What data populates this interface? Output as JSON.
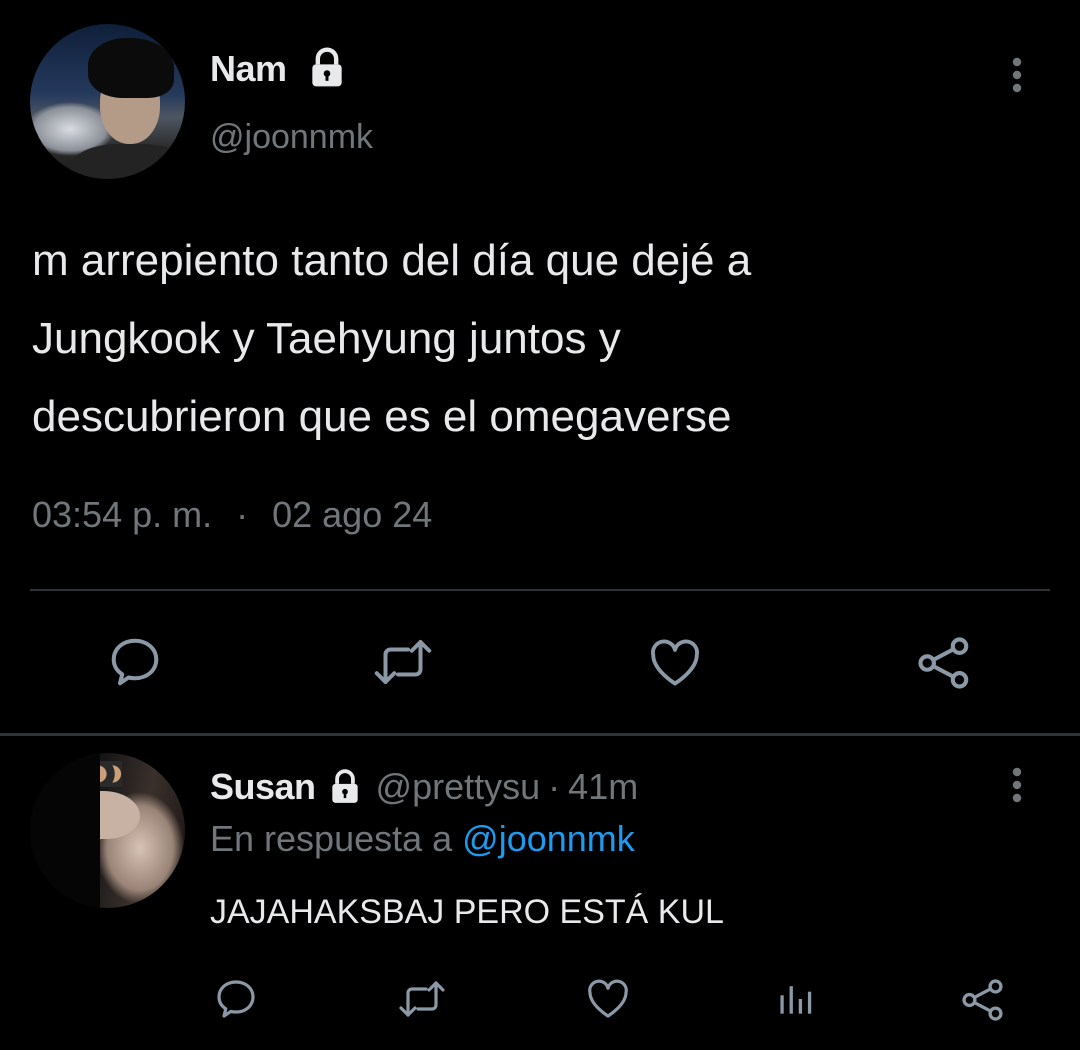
{
  "tweet": {
    "author_name": "Nam",
    "author_handle": "@joonnmk",
    "text": "m arrepiento tanto del día que dejé a\nJungkook y Taehyung juntos y\ndescubrieron que es el omegaverse",
    "time": "03:54 p. m.",
    "separator": "·",
    "date": "02 ago 24",
    "actions": [
      "reply-icon",
      "retweet-icon",
      "like-icon",
      "share-icon"
    ]
  },
  "reply": {
    "author_name": "Susan",
    "author_handle": "@prettysu",
    "separator": "·",
    "age": "41m",
    "replying_to_prefix": "En respuesta a",
    "replying_to_handle": "@joonnmk",
    "text": "JAJAHAKSBAJ PERO ESTÁ KUL",
    "actions": [
      "reply-icon",
      "retweet-icon",
      "like-icon",
      "views-icon",
      "share-icon"
    ]
  },
  "colors": {
    "background": "#000000",
    "primary_text": "#e7e9ea",
    "secondary_text": "#71767b",
    "link": "#1d9bf0",
    "divider": "#2f3336"
  }
}
